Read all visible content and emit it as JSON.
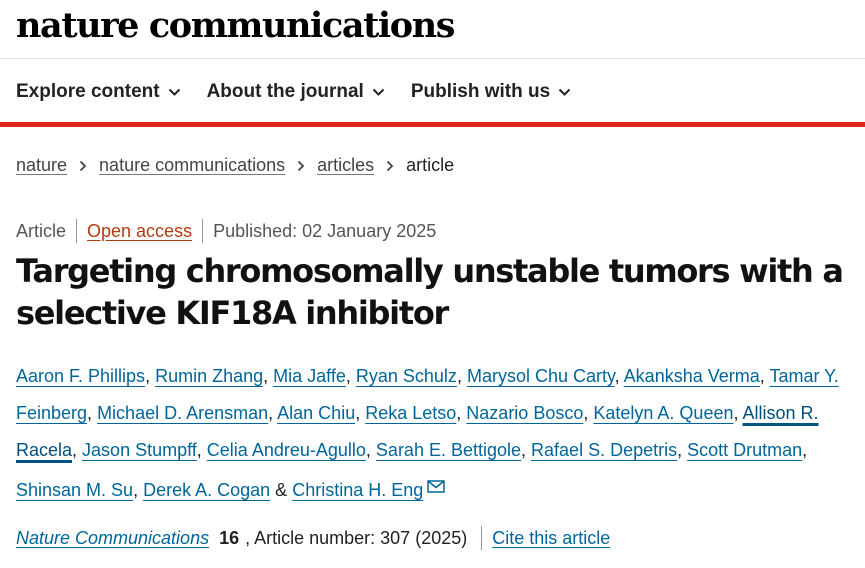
{
  "site": {
    "logo": "nature communications"
  },
  "nav": {
    "items": [
      {
        "label": "Explore content",
        "icon": "chevron-down-icon"
      },
      {
        "label": "About the journal",
        "icon": "chevron-down-icon"
      },
      {
        "label": "Publish with us",
        "icon": "chevron-down-icon"
      }
    ]
  },
  "breadcrumb": {
    "items": [
      {
        "label": "nature"
      },
      {
        "label": "nature communications"
      },
      {
        "label": "articles"
      },
      {
        "label": "article"
      }
    ]
  },
  "article": {
    "type": "Article",
    "access": "Open access",
    "published": "Published: 02 January 2025",
    "title": "Targeting chromosomally unstable tumors with a selective KIF18A inhibitor",
    "authors": [
      "Aaron F. Phillips",
      "Rumin Zhang",
      "Mia Jaffe",
      "Ryan Schulz",
      "Marysol Chu Carty",
      "Akanksha Verma",
      "Tamar Y. Feinberg",
      "Michael D. Arensman",
      "Alan Chiu",
      "Reka Letso",
      "Nazario Bosco",
      "Katelyn A. Queen",
      "Allison R. Racela",
      "Jason Stumpff",
      "Celia Andreu-Agullo",
      "Sarah E. Bettigole",
      "Rafael S. Depetris",
      "Scott Drutman",
      "Shinsan M. Su",
      "Derek A. Cogan",
      "Christina H. Eng"
    ],
    "ampersand": "&",
    "corresponding_icon": "mail-icon",
    "journal": "Nature Communications",
    "volume": "16",
    "article_number": ", Article number: 307 (2025)",
    "cite_label": "Cite this article"
  },
  "colors": {
    "accent_red": "#e0251b",
    "link_blue": "#006699",
    "open_access": "#b33a12"
  }
}
